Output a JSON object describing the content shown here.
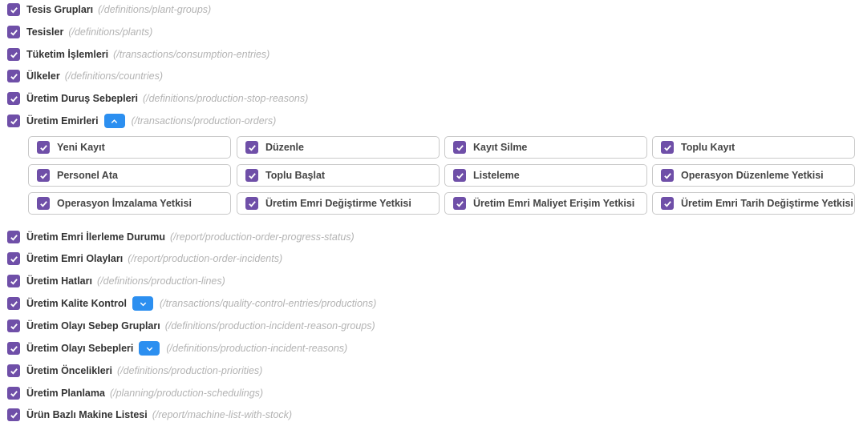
{
  "rows_top": [
    {
      "title": "Tesis Grupları",
      "path": "(/definitions/plant-groups)"
    },
    {
      "title": "Tesisler",
      "path": "(/definitions/plants)"
    },
    {
      "title": "Tüketim İşlemleri",
      "path": "(/transactions/consumption-entries)"
    },
    {
      "title": "Ülkeler",
      "path": "(/definitions/countries)"
    },
    {
      "title": "Üretim Duruş Sebepleri",
      "path": "(/definitions/production-stop-reasons)"
    },
    {
      "title": "Üretim Emirleri",
      "path": "(/transactions/production-orders)",
      "toggle": "chevron-up-icon"
    }
  ],
  "permissions": [
    {
      "label": "Yeni Kayıt"
    },
    {
      "label": "Düzenle"
    },
    {
      "label": "Kayıt Silme"
    },
    {
      "label": "Toplu Kayıt"
    },
    {
      "label": "Personel Ata"
    },
    {
      "label": "Toplu Başlat"
    },
    {
      "label": "Listeleme"
    },
    {
      "label": "Operasyon Düzenleme Yetkisi"
    },
    {
      "label": "Operasyon İmzalama Yetkisi"
    },
    {
      "label": "Üretim Emri Değiştirme Yetkisi"
    },
    {
      "label": "Üretim Emri Maliyet Erişim Yetkisi"
    },
    {
      "label": "Üretim Emri Tarih Değiştirme Yetkisi"
    }
  ],
  "rows_bottom": [
    {
      "title": "Üretim Emri İlerleme Durumu",
      "path": "(/report/production-order-progress-status)"
    },
    {
      "title": "Üretim Emri Olayları",
      "path": "(/report/production-order-incidents)"
    },
    {
      "title": "Üretim Hatları",
      "path": "(/definitions/production-lines)"
    },
    {
      "title": "Üretim Kalite Kontrol",
      "path": "(/transactions/quality-control-entries/productions)",
      "toggle": "chevron-down-icon"
    },
    {
      "title": "Üretim Olayı Sebep Grupları",
      "path": "(/definitions/production-incident-reason-groups)"
    },
    {
      "title": "Üretim Olayı Sebepleri",
      "path": "(/definitions/production-incident-reasons)",
      "toggle": "chevron-down-icon"
    },
    {
      "title": "Üretim Öncelikleri",
      "path": "(/definitions/production-priorities)"
    },
    {
      "title": "Üretim Planlama",
      "path": "(/planning/production-schedulings)"
    },
    {
      "title": "Ürün Bazlı Makine Listesi",
      "path": "(/report/machine-list-with-stock)"
    }
  ],
  "colors": {
    "checkbox": "#6f4fa8",
    "toggle": "#2c8ff0",
    "path_text": "#b3b3b3"
  }
}
